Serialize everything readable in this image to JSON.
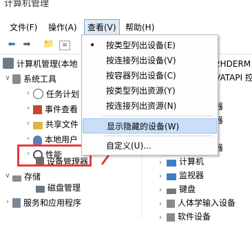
{
  "window": {
    "title": "计算机管理"
  },
  "menubar": {
    "items": [
      "文件(F)",
      "操作(A)",
      "查看(V)",
      "帮助(H)"
    ]
  },
  "toolbar": {
    "icons": [
      "back-arrow-icon",
      "forward-arrow-icon",
      "folder-up-icon",
      "console-tree-icon"
    ]
  },
  "tree": {
    "root": "计算机管理(本地",
    "system_tools": "系统工具",
    "task_scheduler": "任务计划",
    "event_viewer": "事件查看",
    "shared_folders": "共享文件",
    "local_users": "本地用户",
    "performance": "性能",
    "device_manager": "设备管理器",
    "storage": "存储",
    "disk_management": "磁盘管理",
    "services": "服务和应用程序"
  },
  "right": {
    "top_text": "2HDERM",
    "ata_text": "VATAPI 控",
    "item_qi": "器",
    "item_qi2": "器",
    "item_er": "器",
    "computer": "计算机",
    "monitor": "监视器",
    "keyboard": "键盘",
    "hid": "人体学输入设备",
    "software": "软件设备"
  },
  "view_menu": {
    "items": [
      "按类型列出设备(E)",
      "按连接列出设备(V)",
      "按容器列出设备(C)",
      "按类型列出资源(Y)",
      "按连接列出资源(N)",
      "显示隐藏的设备(W)",
      "自定义(U)..."
    ]
  },
  "colors": {
    "highlight": "#c8dff7",
    "annotation_red": "#e8373a",
    "accent_blue": "#1e6fc6"
  }
}
